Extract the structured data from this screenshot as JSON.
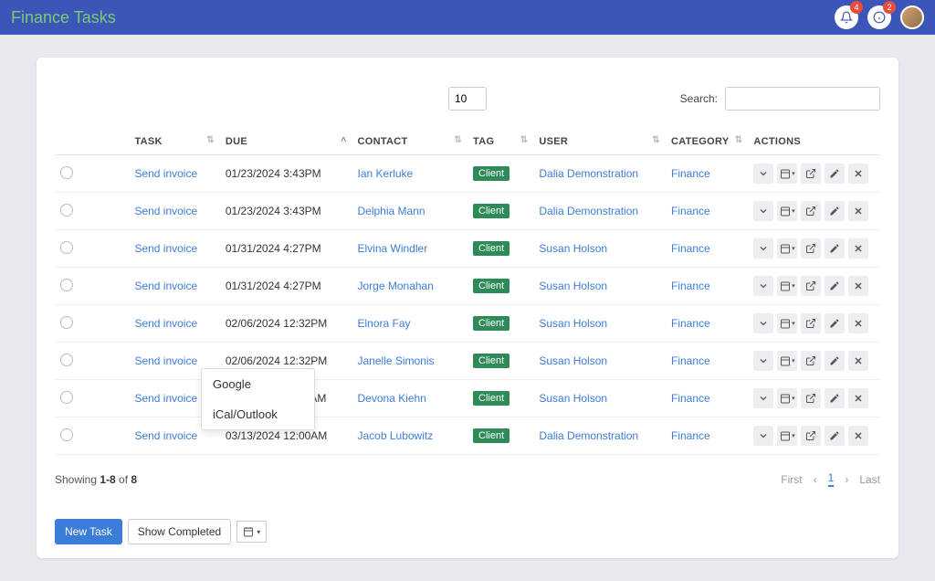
{
  "header": {
    "title": "Finance Tasks",
    "notif_count": "4",
    "info_count": "2"
  },
  "controls": {
    "pagesize": "10",
    "search_label": "Search:",
    "search_placeholder": ""
  },
  "columns": {
    "task": "TASK",
    "due": "DUE",
    "contact": "CONTACT",
    "tag": "TAG",
    "user": "USER",
    "category": "CATEGORY",
    "actions": "ACTIONS"
  },
  "rows": [
    {
      "task": "Send invoice",
      "due": "01/23/2024 3:43PM",
      "contact": "Ian Kerluke",
      "tag": "Client",
      "user": "Dalia Demonstration",
      "category": "Finance"
    },
    {
      "task": "Send invoice",
      "due": "01/23/2024 3:43PM",
      "contact": "Delphia Mann",
      "tag": "Client",
      "user": "Dalia Demonstration",
      "category": "Finance"
    },
    {
      "task": "Send invoice",
      "due": "01/31/2024 4:27PM",
      "contact": "Elvina Windler",
      "tag": "Client",
      "user": "Susan Holson",
      "category": "Finance"
    },
    {
      "task": "Send invoice",
      "due": "01/31/2024 4:27PM",
      "contact": "Jorge Monahan",
      "tag": "Client",
      "user": "Susan Holson",
      "category": "Finance"
    },
    {
      "task": "Send invoice",
      "due": "02/06/2024 12:32PM",
      "contact": "Elnora Fay",
      "tag": "Client",
      "user": "Susan Holson",
      "category": "Finance"
    },
    {
      "task": "Send invoice",
      "due": "02/06/2024 12:32PM",
      "contact": "Janelle Simonis",
      "tag": "Client",
      "user": "Susan Holson",
      "category": "Finance"
    },
    {
      "task": "Send invoice",
      "due": "02/15/2024 11:24AM",
      "contact": "Devona Kiehn",
      "tag": "Client",
      "user": "Susan Holson",
      "category": "Finance"
    },
    {
      "task": "Send invoice",
      "due": "03/13/2024 12:00AM",
      "contact": "Jacob Lubowitz",
      "tag": "Client",
      "user": "Dalia Demonstration",
      "category": "Finance"
    }
  ],
  "footer": {
    "showing_prefix": "Showing ",
    "range": "1-8",
    "of": " of ",
    "total": "8",
    "first": "First",
    "prev": "‹",
    "current": "1",
    "next": "›",
    "last": "Last"
  },
  "buttons": {
    "new_task": "New Task",
    "show_completed": "Show Completed"
  },
  "dropdown": {
    "google": "Google",
    "ical": "iCal/Outlook"
  }
}
